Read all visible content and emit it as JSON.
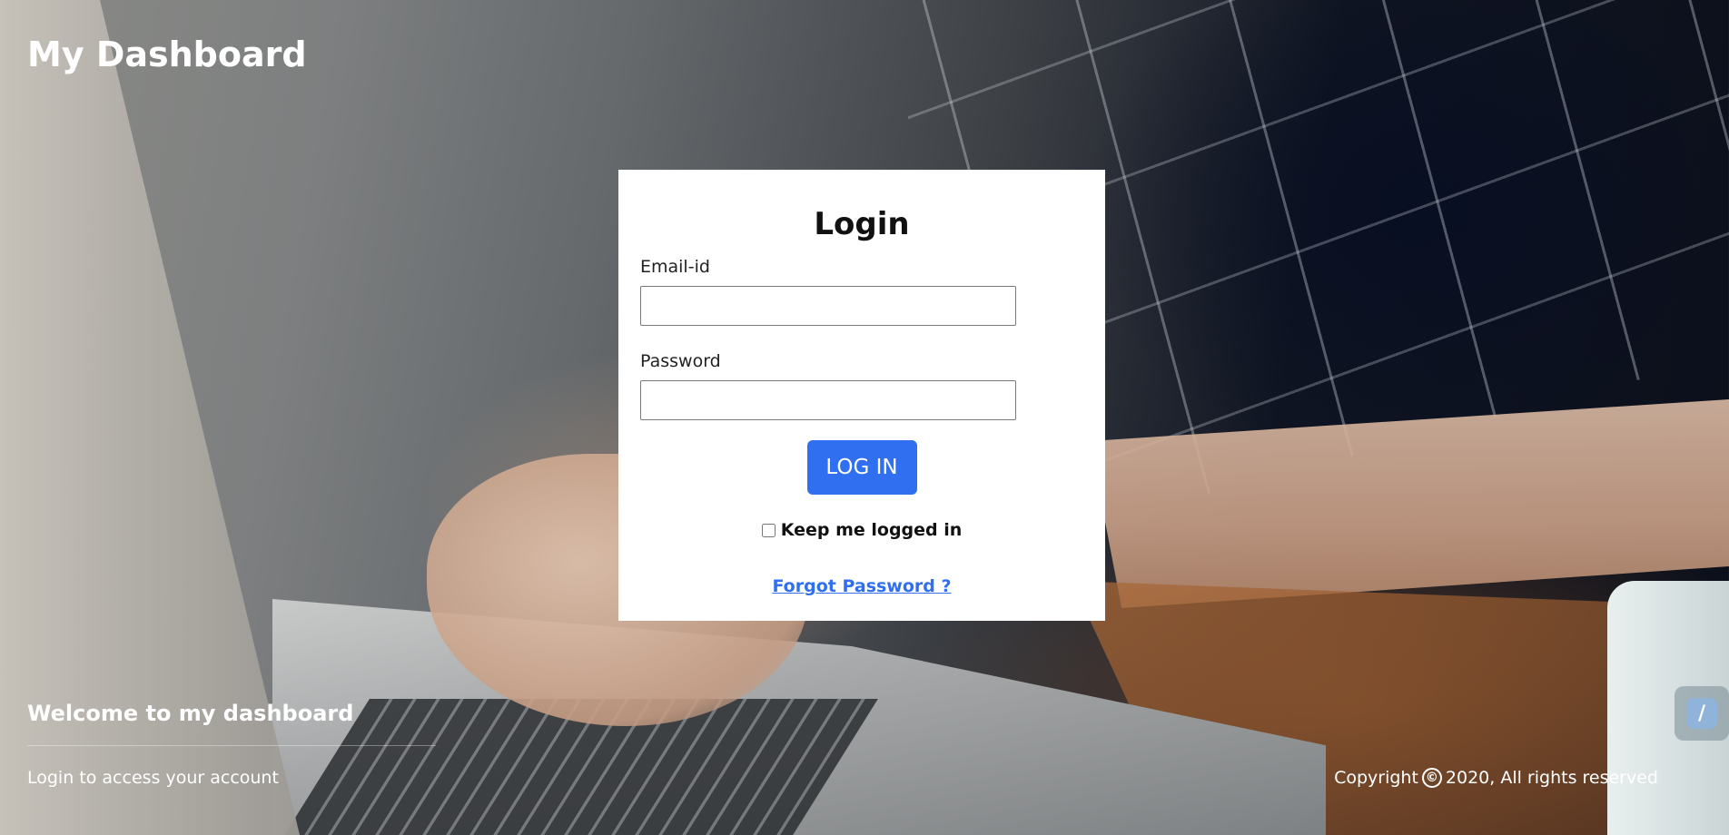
{
  "header": {
    "title": "My Dashboard"
  },
  "login": {
    "heading": "Login",
    "email_label": "Email-id",
    "email_value": "",
    "password_label": "Password",
    "password_value": "",
    "button_label": "LOG IN",
    "remember_label": "Keep me logged in",
    "forgot_label": "Forgot Password ?"
  },
  "footer": {
    "welcome_title": "Welcome to my dashboard",
    "welcome_subtitle": "Login to access your account",
    "copyright_icon": "©",
    "copyright_text": "2020, All rights reserved",
    "copyright_prefix": "Copyright"
  },
  "widget": {
    "icon": "slash-logo-icon",
    "glyph": "/"
  },
  "colors": {
    "accent": "#2f6ff0",
    "card": "#ffffff",
    "text_light": "#ffffff"
  }
}
